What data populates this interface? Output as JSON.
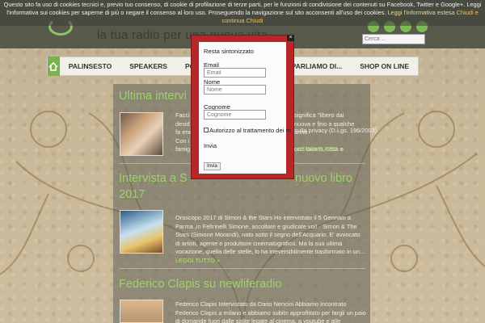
{
  "cookie_bar": {
    "text": "Questo sito fa uso di cookies tecnici e, previo tuo consenso, di cookie di profilazione di terze parti, per le funzioni di condivisione dei contenuti su Facebook, Twitter e Google+. Leggi l'informativa sui cookies per saperne di più o negare il consenso al loro uso. Proseguendo la navigazione sul sito acconsenti all'uso dei cookies.",
    "info_link": "Leggi l'informativa estesa",
    "close_link": "Chiudi e continua",
    "close2_link": "Chiudi"
  },
  "header": {
    "tagline": "la tua radio per una nuova vita",
    "search_placeholder": "Cerca ..."
  },
  "nav": {
    "items": [
      "PALINSESTO",
      "SPEAKERS",
      "PODCAST",
      "",
      "PARLIAMO DI...",
      "SHOP ON LINE"
    ],
    "podcast_partial": "PODC"
  },
  "posts": [
    {
      "title": "Ultima intervi",
      "text_lines": [
        "Facci",
        "desid",
        "fa era",
        "Con i",
        "famig"
      ],
      "right_lines": [
        "significa \"libero dai",
        "nuova e fino a qualche anno",
        "",
        "oro: lavoro, casa e"
      ],
      "more": "LEGGI TUTTO »"
    },
    {
      "title_left": "Intervista a S",
      "title_right": "nuovo libro",
      "title_line2": "2017",
      "text": "Oroscopo 2017 di Simon & the Stars Ho intervistato il 5 Gennaio a Parma ,in Feltrinelli Simone, ascoltate e giudicate voi! · Simon & The Stars (Simone Morandi), nato sotto il segno dell'Acquario. E' avvocato di artisti, agente e produttore cinematografico. Ma la sua ultima vocazione, quella delle stelle, lo ha irreversibilmente trasformato in un...",
      "more": "LEGGI TUTTO »"
    },
    {
      "title": "Federico Clapis su newliferadio",
      "text": "Federico Clapis Intervistato da Dario Nencini Abbiamo incontrato Federico Clapis a milano e abbiamo subito approfittato per fargli un paio di domande fuori dalle solite legate al cinema, a youtube e alle"
    }
  ],
  "privacy_strip": "ge sulla privacy (D.Lgs. 196/2003).",
  "modal": {
    "title": "Resta sintonizzato",
    "email_label": "Email",
    "email_placeholder": "Email",
    "name_label": "Nome",
    "name_placeholder": "Nome",
    "surname_label": "Cognome",
    "surname_placeholder": "Cognome",
    "consent": "Autorizzo al trattamento dei m",
    "send_heading": "Invia",
    "send_button": "Invia",
    "close": "×"
  },
  "colors": {
    "accent_green": "#9bd36a",
    "modal_red": "#b7272a",
    "nav_home_green": "#79b34a"
  }
}
